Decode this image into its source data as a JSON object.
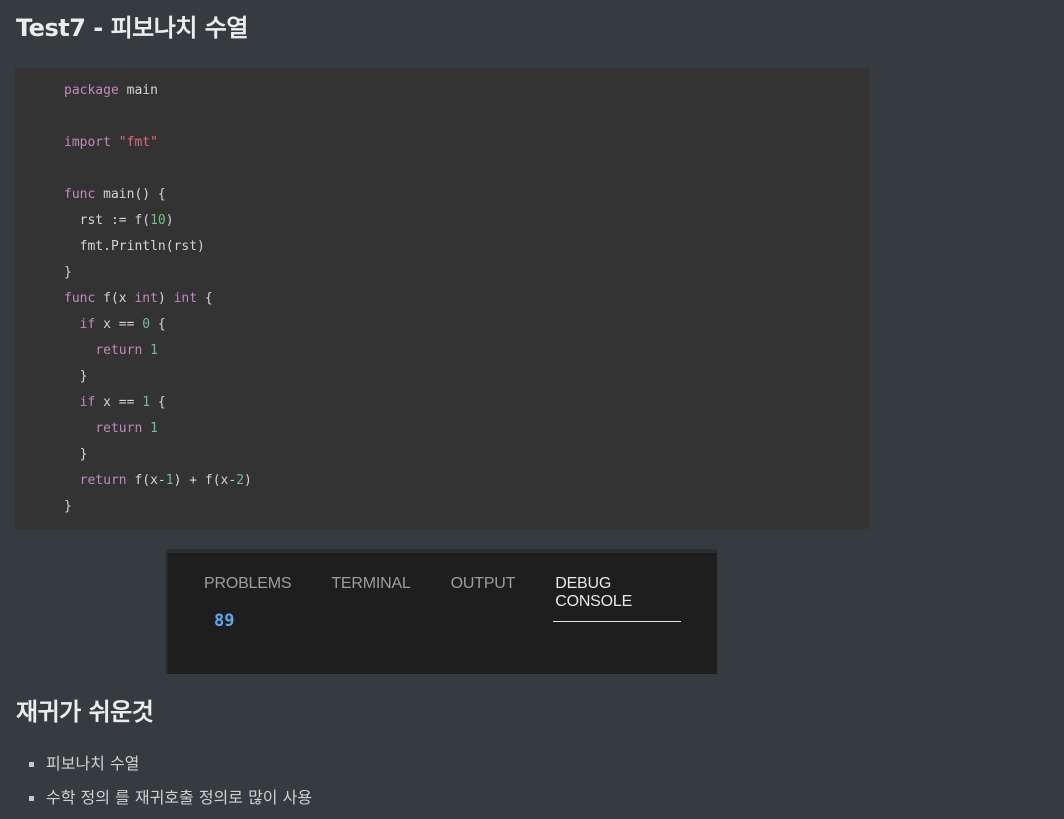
{
  "title": "Test7 - 피보나치 수열",
  "code": {
    "lines": [
      [
        {
          "t": "kw",
          "v": "package"
        },
        {
          "t": "plain",
          "v": " main"
        }
      ],
      [],
      [
        {
          "t": "kw",
          "v": "import"
        },
        {
          "t": "plain",
          "v": " "
        },
        {
          "t": "str",
          "v": "\"fmt\""
        }
      ],
      [],
      [
        {
          "t": "kw",
          "v": "func"
        },
        {
          "t": "plain",
          "v": " main() {"
        }
      ],
      [
        {
          "t": "plain",
          "v": "  rst := f("
        },
        {
          "t": "num",
          "v": "10"
        },
        {
          "t": "plain",
          "v": ")"
        }
      ],
      [
        {
          "t": "plain",
          "v": "  fmt.Println(rst)"
        }
      ],
      [
        {
          "t": "plain",
          "v": "}"
        }
      ],
      [
        {
          "t": "kw",
          "v": "func"
        },
        {
          "t": "plain",
          "v": " f(x "
        },
        {
          "t": "kw",
          "v": "int"
        },
        {
          "t": "plain",
          "v": ") "
        },
        {
          "t": "kw",
          "v": "int"
        },
        {
          "t": "plain",
          "v": " {"
        }
      ],
      [
        {
          "t": "plain",
          "v": "  "
        },
        {
          "t": "kw",
          "v": "if"
        },
        {
          "t": "plain",
          "v": " x == "
        },
        {
          "t": "num",
          "v": "0"
        },
        {
          "t": "plain",
          "v": " {"
        }
      ],
      [
        {
          "t": "plain",
          "v": "    "
        },
        {
          "t": "kw",
          "v": "return"
        },
        {
          "t": "plain",
          "v": " "
        },
        {
          "t": "num",
          "v": "1"
        }
      ],
      [
        {
          "t": "plain",
          "v": "  }"
        }
      ],
      [
        {
          "t": "plain",
          "v": "  "
        },
        {
          "t": "kw",
          "v": "if"
        },
        {
          "t": "plain",
          "v": " x == "
        },
        {
          "t": "num",
          "v": "1"
        },
        {
          "t": "plain",
          "v": " {"
        }
      ],
      [
        {
          "t": "plain",
          "v": "    "
        },
        {
          "t": "kw",
          "v": "return"
        },
        {
          "t": "plain",
          "v": " "
        },
        {
          "t": "num",
          "v": "1"
        }
      ],
      [
        {
          "t": "plain",
          "v": "  }"
        }
      ],
      [
        {
          "t": "plain",
          "v": "  "
        },
        {
          "t": "kw",
          "v": "return"
        },
        {
          "t": "plain",
          "v": " f(x-"
        },
        {
          "t": "num",
          "v": "1"
        },
        {
          "t": "plain",
          "v": ") + f(x-"
        },
        {
          "t": "num",
          "v": "2"
        },
        {
          "t": "plain",
          "v": ")"
        }
      ],
      [
        {
          "t": "plain",
          "v": "}"
        }
      ]
    ]
  },
  "panel": {
    "tabs": [
      {
        "label": "PROBLEMS",
        "active": false
      },
      {
        "label": "TERMINAL",
        "active": false
      },
      {
        "label": "OUTPUT",
        "active": false
      },
      {
        "label": "DEBUG CONSOLE",
        "active": true
      }
    ],
    "output": "89"
  },
  "section": {
    "heading": "재귀가 쉬운것",
    "bullets": [
      "피보나치 수열",
      "수학 정의 를 재귀호출 정의로 많이 사용"
    ]
  },
  "colors": {
    "background": "#363b40",
    "code_background": "#333333",
    "panel_background": "#1e1e1e",
    "keyword": "#c586c0",
    "string": "#e06c75",
    "number": "#6fbf8f",
    "console_output": "#5aa9f0"
  }
}
